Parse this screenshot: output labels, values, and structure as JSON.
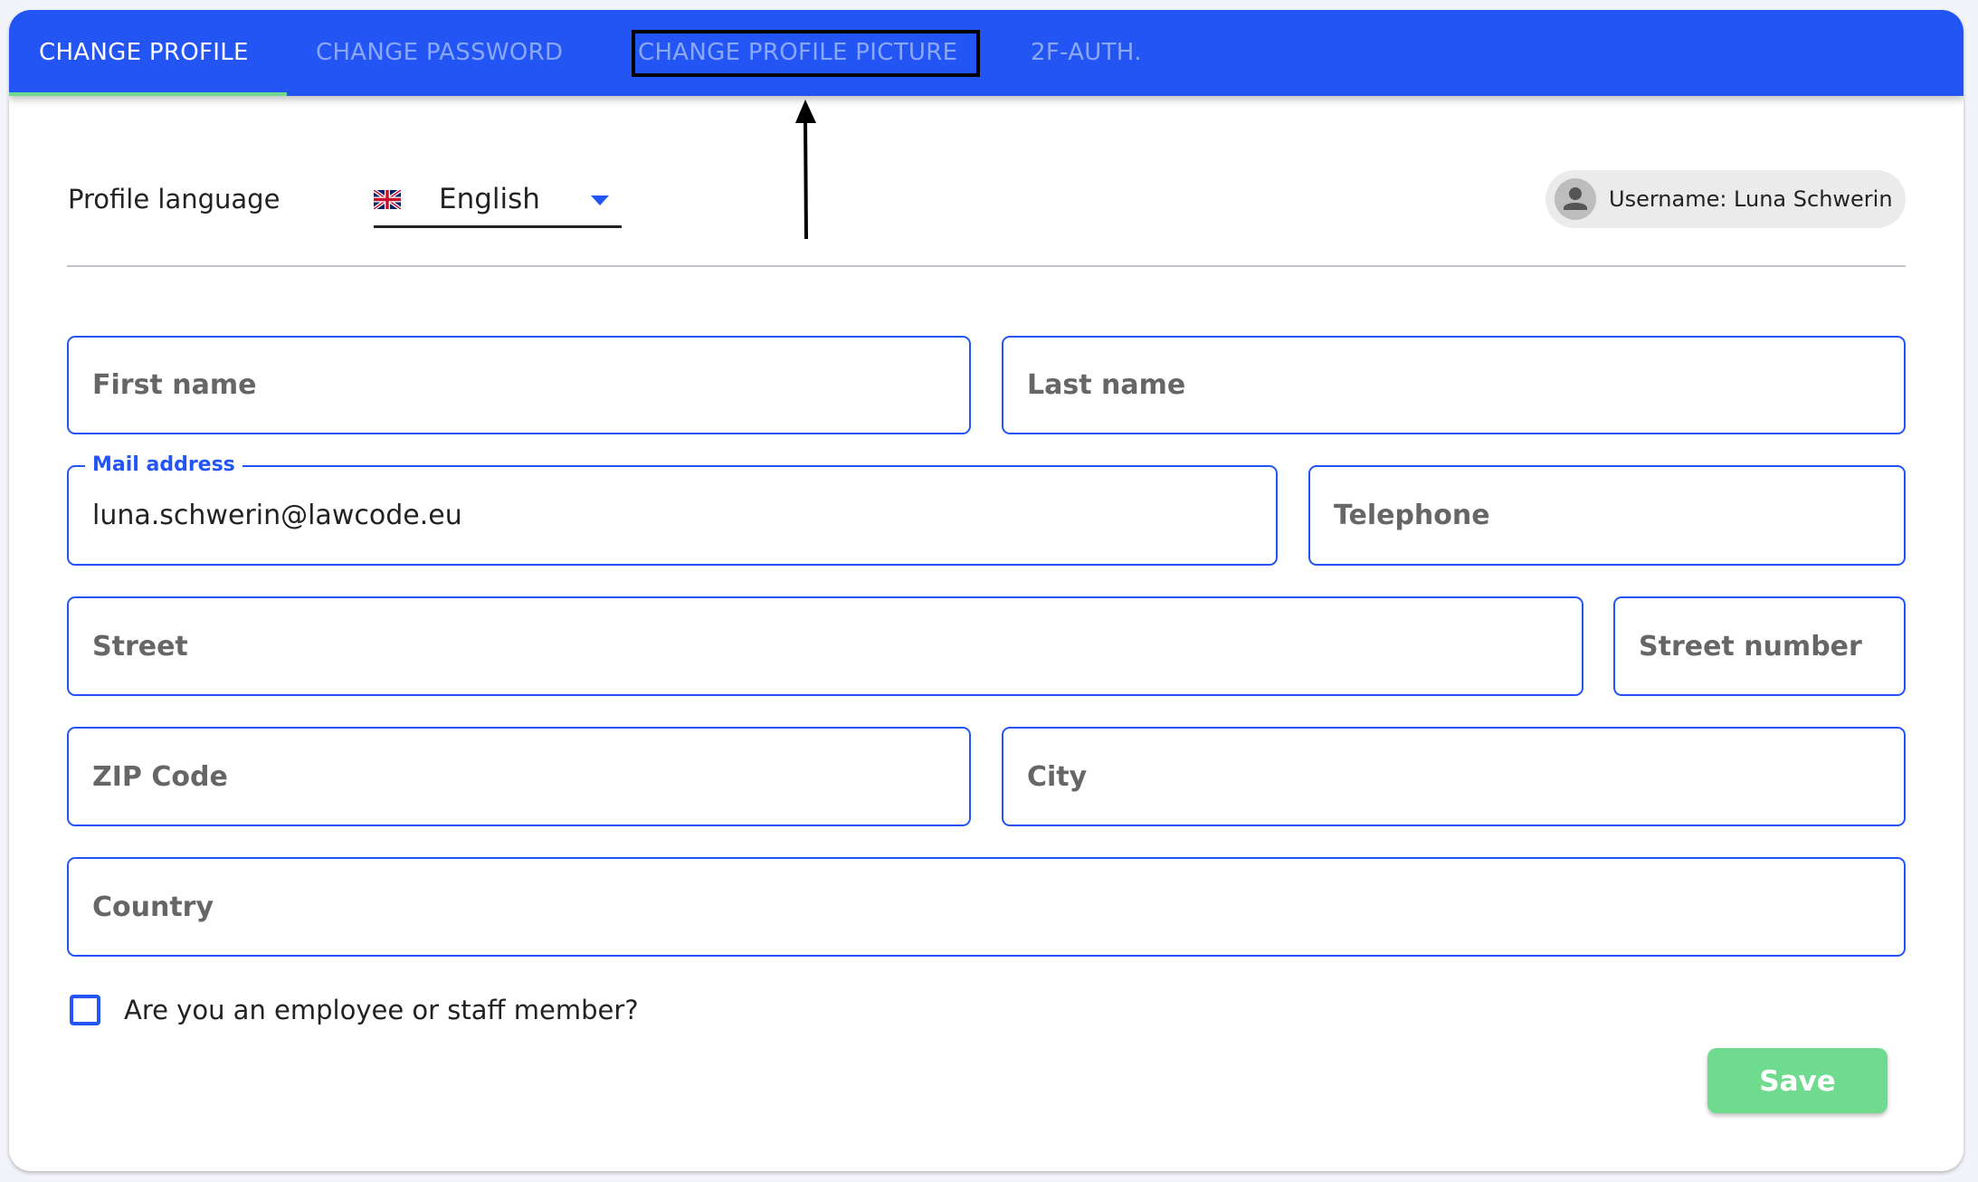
{
  "tabs": [
    {
      "label": "CHANGE PROFILE",
      "active": true
    },
    {
      "label": "CHANGE PASSWORD",
      "active": false
    },
    {
      "label": "CHANGE PROFILE PICTURE",
      "active": false,
      "highlighted": true
    },
    {
      "label": "2F-AUTH.",
      "active": false
    }
  ],
  "language": {
    "label": "Profile language",
    "flag_icon": "uk-flag-icon",
    "selected": "English"
  },
  "user_chip": {
    "icon": "person-icon",
    "text": "Username: Luna Schwerin"
  },
  "form": {
    "first_name": {
      "placeholder": "First name",
      "value": ""
    },
    "last_name": {
      "placeholder": "Last name",
      "value": ""
    },
    "mail": {
      "label": "Mail address",
      "value": "luna.schwerin@lawcode.eu"
    },
    "telephone": {
      "placeholder": "Telephone",
      "value": ""
    },
    "street": {
      "placeholder": "Street",
      "value": ""
    },
    "street_number": {
      "placeholder": "Street number",
      "value": ""
    },
    "zip": {
      "placeholder": "ZIP Code",
      "value": ""
    },
    "city": {
      "placeholder": "City",
      "value": ""
    },
    "country": {
      "placeholder": "Country",
      "value": ""
    },
    "employee_checkbox": {
      "label": "Are you an employee or staff member?",
      "checked": false
    }
  },
  "actions": {
    "save_label": "Save"
  },
  "colors": {
    "primary": "#2355f5",
    "success": "#6edb8e",
    "tab_inactive": "#8aa8f8"
  }
}
